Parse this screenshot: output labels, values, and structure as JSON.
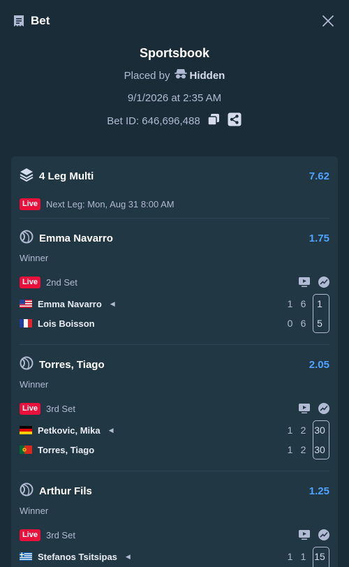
{
  "header": {
    "title": "Bet",
    "title_icon": "bet-slip-icon",
    "close_icon": "close-icon"
  },
  "summary": {
    "provider": "Sportsbook",
    "placed_by_label": "Placed by",
    "placed_by_user": "Hidden",
    "datetime": "9/1/2026 at 2:35 AM",
    "bet_id_label": "Bet ID: 646,696,488"
  },
  "multi": {
    "label": "4 Leg Multi",
    "odds": "7.62",
    "live_label": "Live",
    "next_leg": "Next Leg: Mon, Aug 31 8:00 AM"
  },
  "legs": [
    {
      "name": "Emma Navarro",
      "odds": "1.75",
      "market": "Winner",
      "live_label": "Live",
      "set": "2nd Set",
      "players": [
        {
          "name": "Emma Navarro",
          "flag": "us",
          "serving": true,
          "sets": [
            "1",
            "6"
          ],
          "current": "1"
        },
        {
          "name": "Lois Boisson",
          "flag": "fr",
          "serving": false,
          "sets": [
            "0",
            "6"
          ],
          "current": "5"
        }
      ]
    },
    {
      "name": "Torres, Tiago",
      "odds": "2.05",
      "market": "Winner",
      "live_label": "Live",
      "set": "3rd Set",
      "players": [
        {
          "name": "Petkovic, Mika",
          "flag": "de",
          "serving": true,
          "sets": [
            "1",
            "2"
          ],
          "current": "30"
        },
        {
          "name": "Torres, Tiago",
          "flag": "pt",
          "serving": false,
          "sets": [
            "1",
            "2"
          ],
          "current": "30"
        }
      ]
    },
    {
      "name": "Arthur Fils",
      "odds": "1.25",
      "market": "Winner",
      "live_label": "Live",
      "set": "3rd Set",
      "players": [
        {
          "name": "Stefanos Tsitsipas",
          "flag": "gr",
          "serving": true,
          "sets": [
            "1",
            "1"
          ],
          "current": "15"
        }
      ]
    }
  ],
  "colors": {
    "background": "#1a2c38",
    "card": "#213743",
    "odds": "#4fa3ff",
    "live": "#e9113c"
  }
}
